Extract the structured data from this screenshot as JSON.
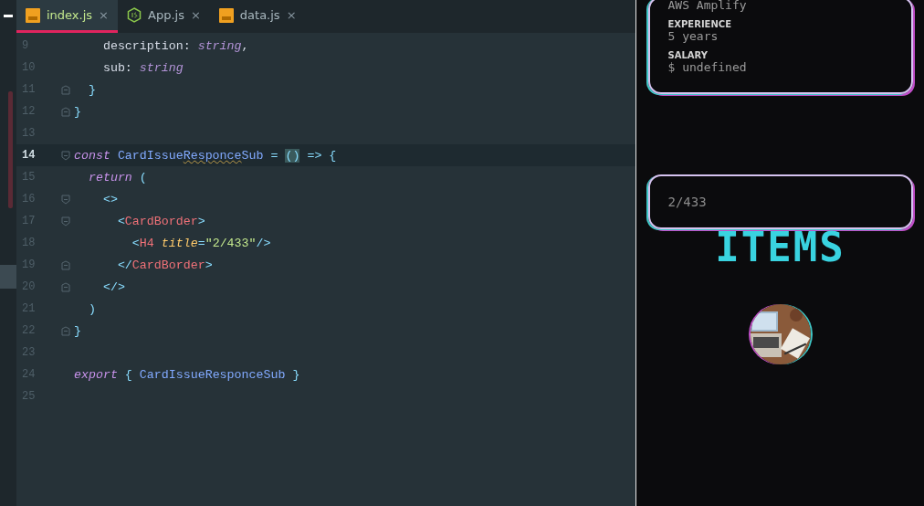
{
  "tabs": [
    {
      "label": "index.js",
      "kind": "js",
      "selected": true,
      "close": "×"
    },
    {
      "label": "App.js",
      "kind": "node",
      "selected": false,
      "close": "×"
    },
    {
      "label": "data.js",
      "kind": "js",
      "selected": false,
      "close": "×"
    }
  ],
  "editor": {
    "lines": [
      {
        "number": "9",
        "current": false,
        "kind": "plain",
        "tokens": [
          {
            "kind": "plain",
            "text": "    description: "
          },
          {
            "kind": "type",
            "text": "string"
          },
          {
            "kind": "plain",
            "text": ","
          }
        ]
      },
      {
        "number": "10",
        "current": false,
        "kind": "plain",
        "tokens": [
          {
            "kind": "plain",
            "text": "    sub: "
          },
          {
            "kind": "type",
            "text": "string"
          }
        ]
      },
      {
        "number": "11",
        "current": false,
        "kind": "closer",
        "tokens": [
          {
            "kind": "punct",
            "text": "  }"
          }
        ]
      },
      {
        "number": "12",
        "current": false,
        "kind": "closer",
        "tokens": [
          {
            "kind": "punct",
            "text": "}"
          }
        ]
      },
      {
        "number": "13",
        "current": false,
        "kind": "plain"
      },
      {
        "number": "14",
        "current": true,
        "kind": "opener",
        "tokens": [
          {
            "kind": "keyword",
            "text": "const"
          },
          {
            "kind": "name",
            "text": " CardIssue"
          },
          {
            "kind": "misspelled",
            "text": "Responce"
          },
          {
            "kind": "name",
            "text": "Sub"
          },
          {
            "kind": "punct",
            "text": " = "
          },
          {
            "kind": "matched",
            "text": "()"
          },
          {
            "kind": "punct",
            "text": " => {"
          }
        ]
      },
      {
        "number": "15",
        "current": false,
        "kind": "plain",
        "tokens": [
          {
            "kind": "keyword",
            "text": "  return"
          },
          {
            "kind": "punct",
            "text": " ("
          }
        ]
      },
      {
        "number": "16",
        "current": false,
        "kind": "opener",
        "tokens": [
          {
            "kind": "punct",
            "text": "    <>"
          }
        ]
      },
      {
        "number": "17",
        "current": false,
        "kind": "opener",
        "tokens": [
          {
            "kind": "punct",
            "text": "      <"
          },
          {
            "kind": "tag",
            "text": "CardBorder"
          },
          {
            "kind": "punct",
            "text": ">"
          }
        ]
      },
      {
        "number": "18",
        "current": false,
        "kind": "plain",
        "tokens": [
          {
            "kind": "punct",
            "text": "        <"
          },
          {
            "kind": "tag",
            "text": "H4"
          },
          {
            "kind": "attr",
            "text": " title"
          },
          {
            "kind": "punct",
            "text": "="
          },
          {
            "kind": "string",
            "text": "\"2/433\""
          },
          {
            "kind": "punct",
            "text": "/>"
          }
        ]
      },
      {
        "number": "19",
        "current": false,
        "kind": "closer",
        "tokens": [
          {
            "kind": "punct",
            "text": "      </"
          },
          {
            "kind": "tag",
            "text": "CardBorder"
          },
          {
            "kind": "punct",
            "text": ">"
          }
        ]
      },
      {
        "number": "20",
        "current": false,
        "kind": "closer",
        "tokens": [
          {
            "kind": "punct",
            "text": "    </>"
          }
        ]
      },
      {
        "number": "21",
        "current": false,
        "kind": "plain",
        "tokens": [
          {
            "kind": "punct",
            "text": "  )"
          }
        ]
      },
      {
        "number": "22",
        "current": false,
        "kind": "closer",
        "tokens": [
          {
            "kind": "punct",
            "text": "}"
          }
        ]
      },
      {
        "number": "23",
        "current": false,
        "kind": "plain"
      },
      {
        "number": "24",
        "current": false,
        "kind": "plain",
        "tokens": [
          {
            "kind": "keyword",
            "text": "export"
          },
          {
            "kind": "punct",
            "text": " { "
          },
          {
            "kind": "name",
            "text": "CardIssueResponceSub"
          },
          {
            "kind": "punct",
            "text": " }"
          }
        ]
      },
      {
        "number": "25",
        "current": false,
        "kind": "plain"
      }
    ]
  },
  "preview": {
    "profile_card": {
      "fields": [
        {
          "value": "AWS Amplify"
        },
        {
          "label": "EXPERIENCE",
          "value": "5 years"
        },
        {
          "label": "SALARY",
          "value": "$ undefined"
        }
      ]
    },
    "counter_card": {
      "text": "2/433"
    },
    "heading": "ITEMS"
  }
}
